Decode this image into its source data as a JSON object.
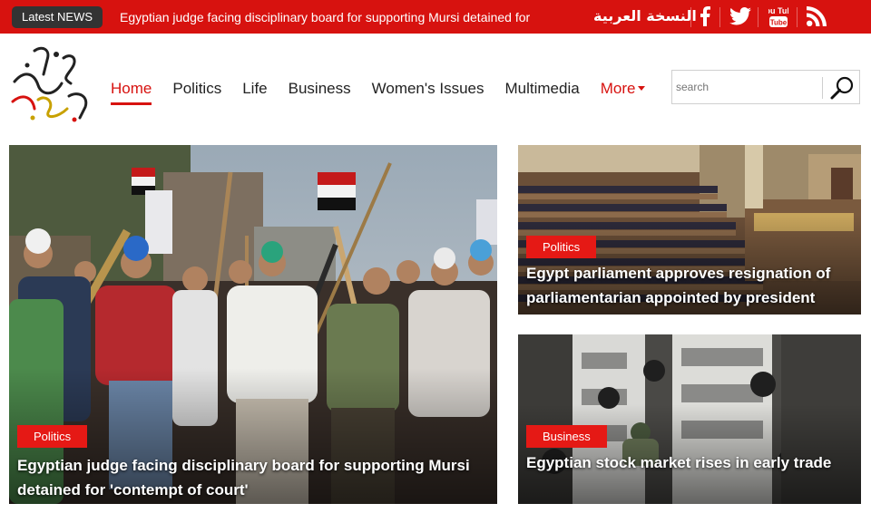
{
  "topbar": {
    "latest_label": "Latest NEWS",
    "ticker_text": "Egyptian judge facing disciplinary board for supporting Mursi detained for",
    "arabic_link": "النسخة العربية",
    "social": [
      "facebook-icon",
      "twitter-icon",
      "youtube-icon",
      "rss-icon"
    ],
    "youtube_text": "You Tube"
  },
  "colors": {
    "brand_red": "#d7120f",
    "tag_red": "#e51915",
    "badge_dark": "#333333"
  },
  "nav": {
    "items": [
      "Home",
      "Politics",
      "Life",
      "Business",
      "Women's Issues",
      "Multimedia"
    ],
    "more_label": "More",
    "active": "Home"
  },
  "search": {
    "placeholder": "search"
  },
  "cards": {
    "main": {
      "category": "Politics",
      "headline": "Egyptian judge facing disciplinary board for supporting Mursi detained for 'contempt of court'"
    },
    "top_right": {
      "category": "Politics",
      "headline": "Egypt parliament approves resignation of parliamentarian appointed by president"
    },
    "bottom_right": {
      "category": "Business",
      "headline": "Egyptian stock market rises in early trade"
    }
  }
}
